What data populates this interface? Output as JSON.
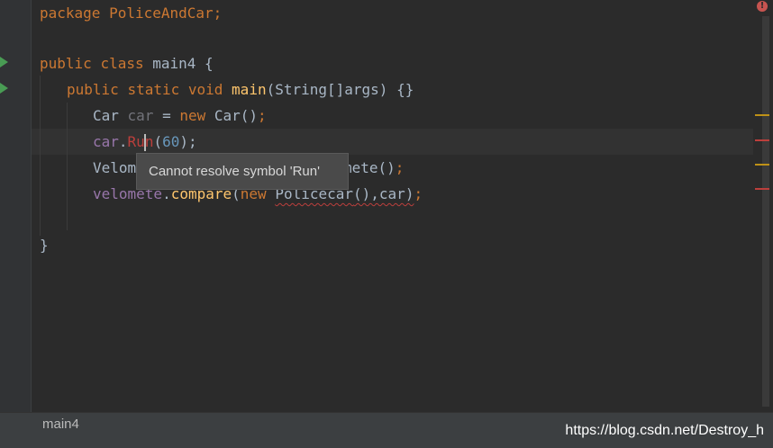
{
  "code_lines": {
    "l1": {
      "kw": "package ",
      "pkg": "PoliceAndCar;"
    },
    "l3": {
      "kw1": "public ",
      "kw2": "class ",
      "name": "main4 ",
      "brace": "{"
    },
    "l4": {
      "kw1": "public ",
      "kw2": "static ",
      "kw3": "void ",
      "fn": "main",
      "params": "(String[]args) {}"
    },
    "l5": {
      "type": "Car ",
      "var": "car",
      "eq": " = ",
      "kw": "new ",
      "ctor": "Car()",
      "semi": ";"
    },
    "l6": {
      "obj": "car",
      "dot": ".",
      "err1": "Ru",
      "err2": "n",
      "open": "(",
      "num": "60",
      "close": ");"
    },
    "l7": {
      "visible_start": "Velom",
      "visible_end": "mete()",
      "semi": ";"
    },
    "l8": {
      "var": "velomete",
      "dot": ".",
      "method": "compare",
      "open": "(",
      "kw": "new ",
      "ctor": "Policecar",
      "args": "(),car)",
      "semi": ";"
    },
    "l10": {
      "brace": "}"
    }
  },
  "tooltip": {
    "text": "Cannot resolve symbol 'Run'"
  },
  "errors": {
    "indicator": "!"
  },
  "statusbar": {
    "breadcrumb": "main4"
  },
  "watermark": "https://blog.csdn.net/Destroy_h",
  "colors": {
    "background": "#2b2b2b",
    "keyword": "#cc7832",
    "function": "#ffc66d",
    "number": "#6897bb",
    "error": "#bc3f3c",
    "warning_marker": "#be9117",
    "error_marker": "#bc3f3c"
  }
}
